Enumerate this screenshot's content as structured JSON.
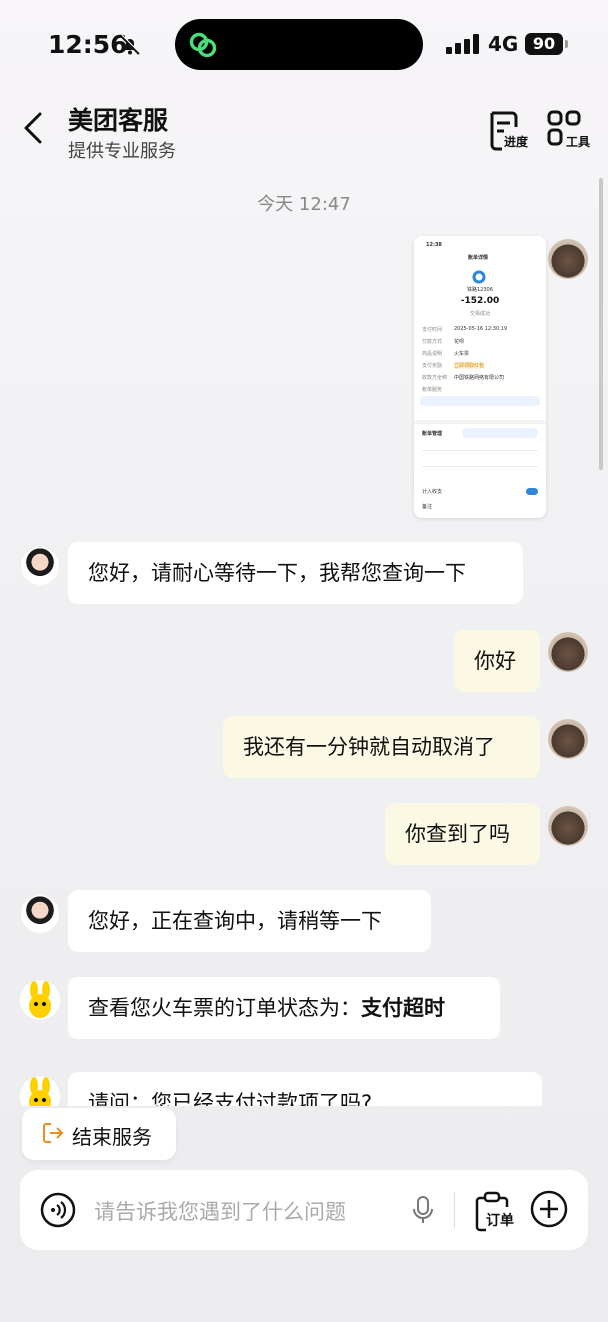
{
  "status_bar": {
    "time": "12:56",
    "network": "4G",
    "battery": "90"
  },
  "header": {
    "title": "美团客服",
    "subtitle": "提供专业服务",
    "progress_label": "进度",
    "tools_label": "工具"
  },
  "chat": {
    "date_separator": "今天 12:47",
    "screenshot": {
      "time": "12:38",
      "title": "账单详情",
      "merchant": "铁路12306",
      "amount": "-152.00",
      "status": "交易成功",
      "rows": [
        "支付时间",
        "付款方式",
        "商品说明",
        "支付奖励",
        "收款方全称",
        "账单服务"
      ],
      "values": [
        "2025-05-16 12:30:19",
        "花呗",
        "火车票",
        "立即领取红包",
        "中国铁路网络有限公司",
        ""
      ],
      "section": "账单管理",
      "toggle_label": "计入收支",
      "note_label": "备注"
    },
    "messages": [
      {
        "from": "agent",
        "text": "您好，请耐心等待一下，我帮您查询一下"
      },
      {
        "from": "user",
        "text": "你好"
      },
      {
        "from": "user",
        "text": "我还有一分钟就自动取消了"
      },
      {
        "from": "user",
        "text": "你查到了吗"
      },
      {
        "from": "agent",
        "text": "您好，正在查询中，请稍等一下"
      },
      {
        "from": "bot",
        "text_prefix": "查看您火车票的订单状态为：",
        "text_bold": "支付超时"
      },
      {
        "from": "bot",
        "text": "请问：您已经支付过款项了吗?"
      }
    ]
  },
  "end_service_label": "结束服务",
  "composer": {
    "placeholder": "请告诉我您遇到了什么问题",
    "order_label": "订单"
  },
  "colors": {
    "user_bubble": "#fbf8e4",
    "agent_bubble": "#ffffff",
    "brand_yellow": "#ffd100"
  }
}
